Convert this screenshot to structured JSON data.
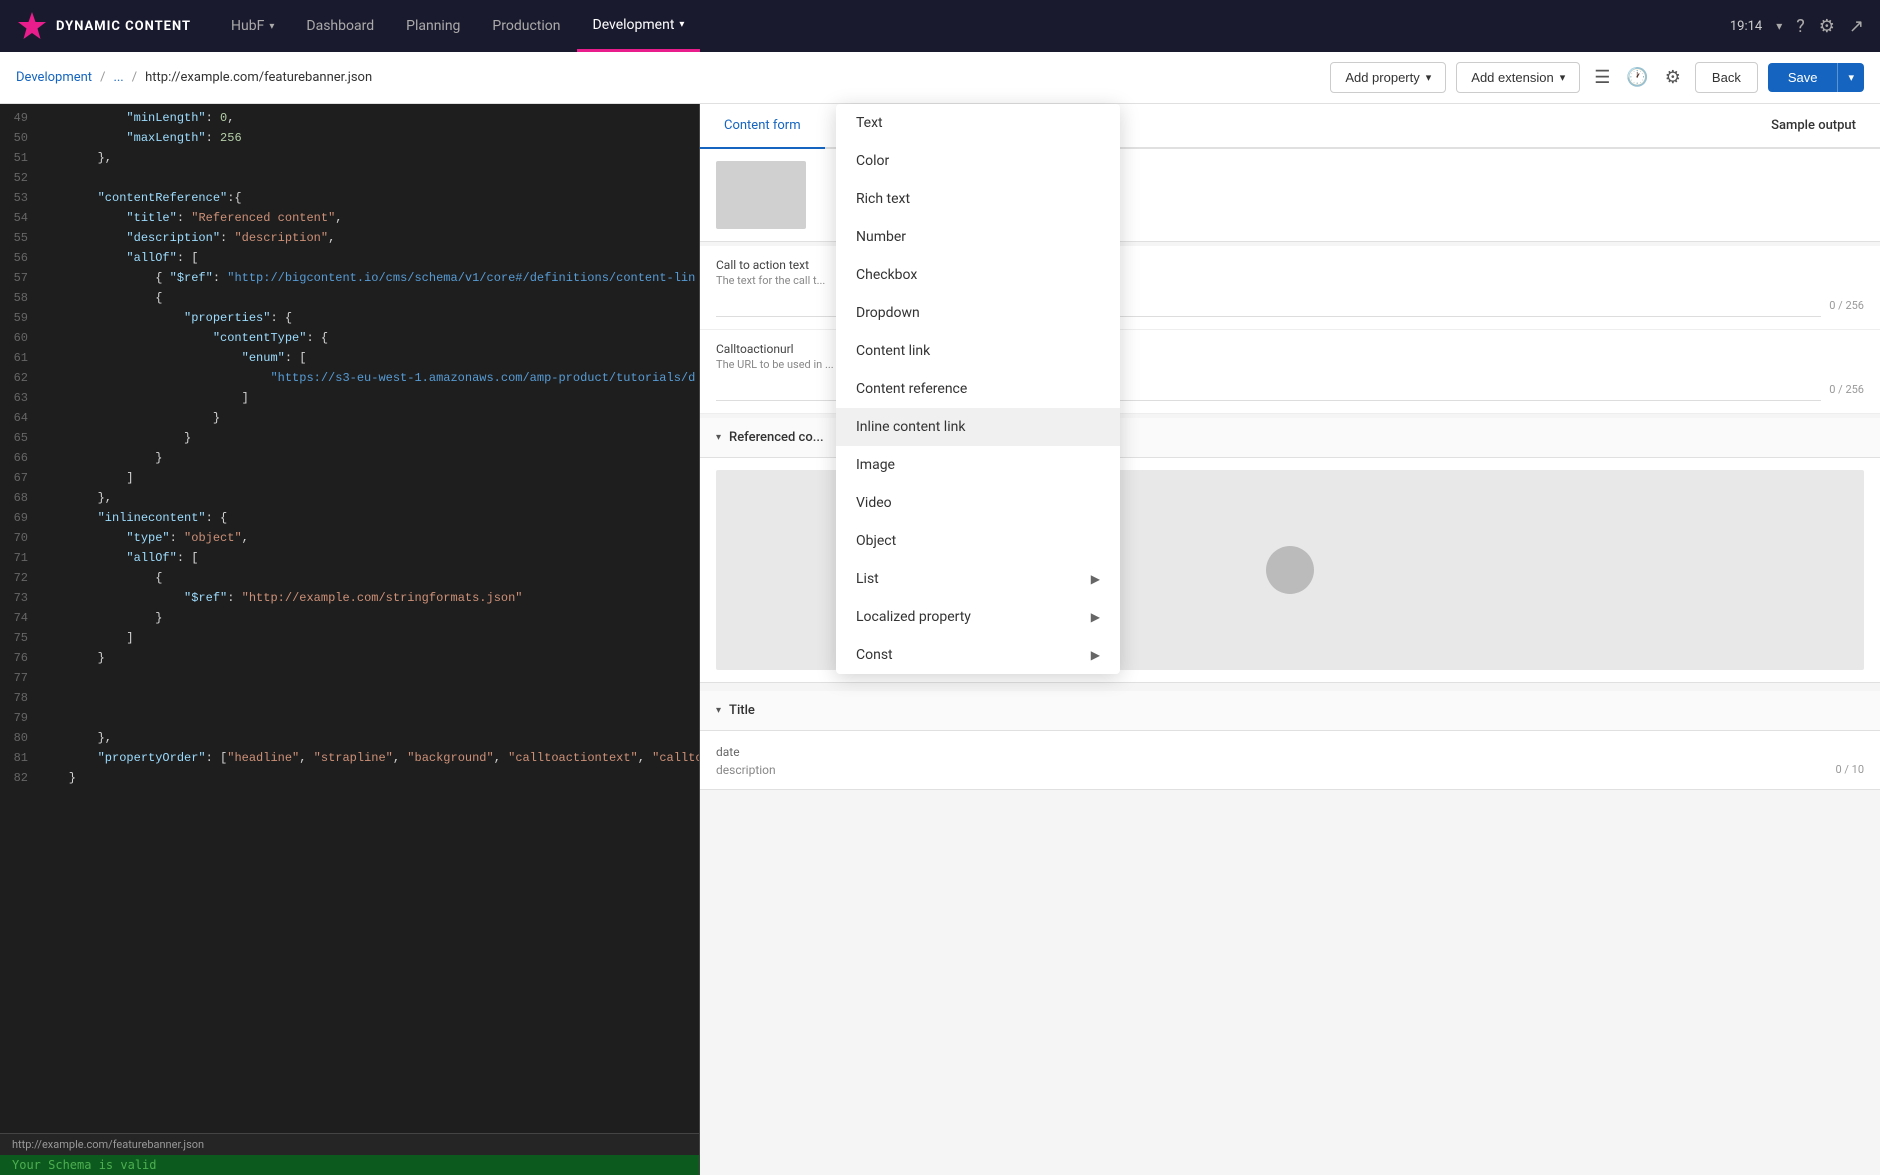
{
  "topnav": {
    "app_name": "DYNAMIC CONTENT",
    "items": [
      {
        "id": "hubf",
        "label": "HubF",
        "has_chevron": true,
        "active": false
      },
      {
        "id": "dashboard",
        "label": "Dashboard",
        "has_chevron": false,
        "active": false
      },
      {
        "id": "planning",
        "label": "Planning",
        "has_chevron": false,
        "active": false
      },
      {
        "id": "production",
        "label": "Production",
        "has_chevron": false,
        "active": false
      },
      {
        "id": "development",
        "label": "Development",
        "has_chevron": true,
        "active": true
      }
    ],
    "time": "19:14",
    "has_chevron": true
  },
  "breadcrumb": {
    "items": [
      "Development",
      "...",
      "http://example.com/featurebanner.json"
    ]
  },
  "toolbar": {
    "add_property_label": "Add property",
    "add_extension_label": "Add extension",
    "back_label": "Back",
    "save_label": "Save"
  },
  "dropdown_menu": {
    "items": [
      {
        "id": "text",
        "label": "Text",
        "has_arrow": false
      },
      {
        "id": "color",
        "label": "Color",
        "has_arrow": false
      },
      {
        "id": "rich-text",
        "label": "Rich text",
        "has_arrow": false
      },
      {
        "id": "number",
        "label": "Number",
        "has_arrow": false
      },
      {
        "id": "checkbox",
        "label": "Checkbox",
        "has_arrow": false
      },
      {
        "id": "dropdown",
        "label": "Dropdown",
        "has_arrow": false
      },
      {
        "id": "content-link",
        "label": "Content link",
        "has_arrow": false
      },
      {
        "id": "content-reference",
        "label": "Content reference",
        "has_arrow": false
      },
      {
        "id": "inline-content-link",
        "label": "Inline content link",
        "has_arrow": false
      },
      {
        "id": "image",
        "label": "Image",
        "has_arrow": false
      },
      {
        "id": "video",
        "label": "Video",
        "has_arrow": false
      },
      {
        "id": "object",
        "label": "Object",
        "has_arrow": false
      },
      {
        "id": "list",
        "label": "List",
        "has_arrow": true
      },
      {
        "id": "localized-property",
        "label": "Localized property",
        "has_arrow": true
      },
      {
        "id": "const",
        "label": "Const",
        "has_arrow": true
      }
    ]
  },
  "code_editor": {
    "lines": [
      {
        "num": 49,
        "content": "            \"minLength\": 0,"
      },
      {
        "num": 50,
        "content": "            \"maxLength\": 256"
      },
      {
        "num": 51,
        "content": "        },"
      },
      {
        "num": 52,
        "content": ""
      },
      {
        "num": 53,
        "content": "        \"contentReference\":{"
      },
      {
        "num": 54,
        "content": "            \"title\": \"Referenced content\","
      },
      {
        "num": 55,
        "content": "            \"description\": \"description\","
      },
      {
        "num": 56,
        "content": "            \"allOf\": ["
      },
      {
        "num": 57,
        "content": "                { \"$ref\": \"http://bigcontent.io/cms/schema/v1/core#/definitions/content-lin"
      },
      {
        "num": 58,
        "content": "                {"
      },
      {
        "num": 59,
        "content": "                    \"properties\": {"
      },
      {
        "num": 60,
        "content": "                        \"contentType\": {"
      },
      {
        "num": 61,
        "content": "                            \"enum\": ["
      },
      {
        "num": 62,
        "content": "                                \"https://s3-eu-west-1.amazonaws.com/amp-product/tutorials/d"
      },
      {
        "num": 63,
        "content": "                            ]"
      },
      {
        "num": 64,
        "content": "                        }"
      },
      {
        "num": 65,
        "content": "                    }"
      },
      {
        "num": 66,
        "content": "                }"
      },
      {
        "num": 67,
        "content": "            ]"
      },
      {
        "num": 68,
        "content": "        },"
      },
      {
        "num": 69,
        "content": "        \"inlinecontent\": {"
      },
      {
        "num": 70,
        "content": "            \"type\": \"object\","
      },
      {
        "num": 71,
        "content": "            \"allOf\": ["
      },
      {
        "num": 72,
        "content": "                {"
      },
      {
        "num": 73,
        "content": "                    \"$ref\": \"http://example.com/stringformats.json\""
      },
      {
        "num": 74,
        "content": "                }"
      },
      {
        "num": 75,
        "content": "            ]"
      },
      {
        "num": 76,
        "content": "        }"
      },
      {
        "num": 77,
        "content": ""
      },
      {
        "num": 78,
        "content": ""
      },
      {
        "num": 79,
        "content": ""
      },
      {
        "num": 80,
        "content": "        },"
      },
      {
        "num": 81,
        "content": "        \"propertyOrder\": [\"headline\", \"strapline\", \"background\", \"calltoactiontext\", \"calltoa"
      },
      {
        "num": 82,
        "content": "    }"
      }
    ]
  },
  "status_bar": {
    "file": "http://example.com/featurebanner.json",
    "valid_message": "Your Schema is valid"
  },
  "right_panel": {
    "tabs": [
      "Content form",
      "Sample output"
    ],
    "active_tab": "Content form",
    "sample_output_label": "Sample output",
    "sections": [
      {
        "id": "call-to-action",
        "label": "Call to action text",
        "description": "The text for the call t...",
        "counter": "0 / 256",
        "has_image": false
      },
      {
        "id": "calltoactionurl",
        "label": "Calltoactionurl",
        "description": "The URL to be used in ...",
        "counter": "0 / 256",
        "has_image": false
      },
      {
        "id": "referenced-content",
        "label": "Referenced co...",
        "collapsed": false,
        "has_image": true
      }
    ],
    "title_section": {
      "label": "Title",
      "date_label": "date",
      "desc_label": "description",
      "counter": "0 / 10"
    }
  }
}
